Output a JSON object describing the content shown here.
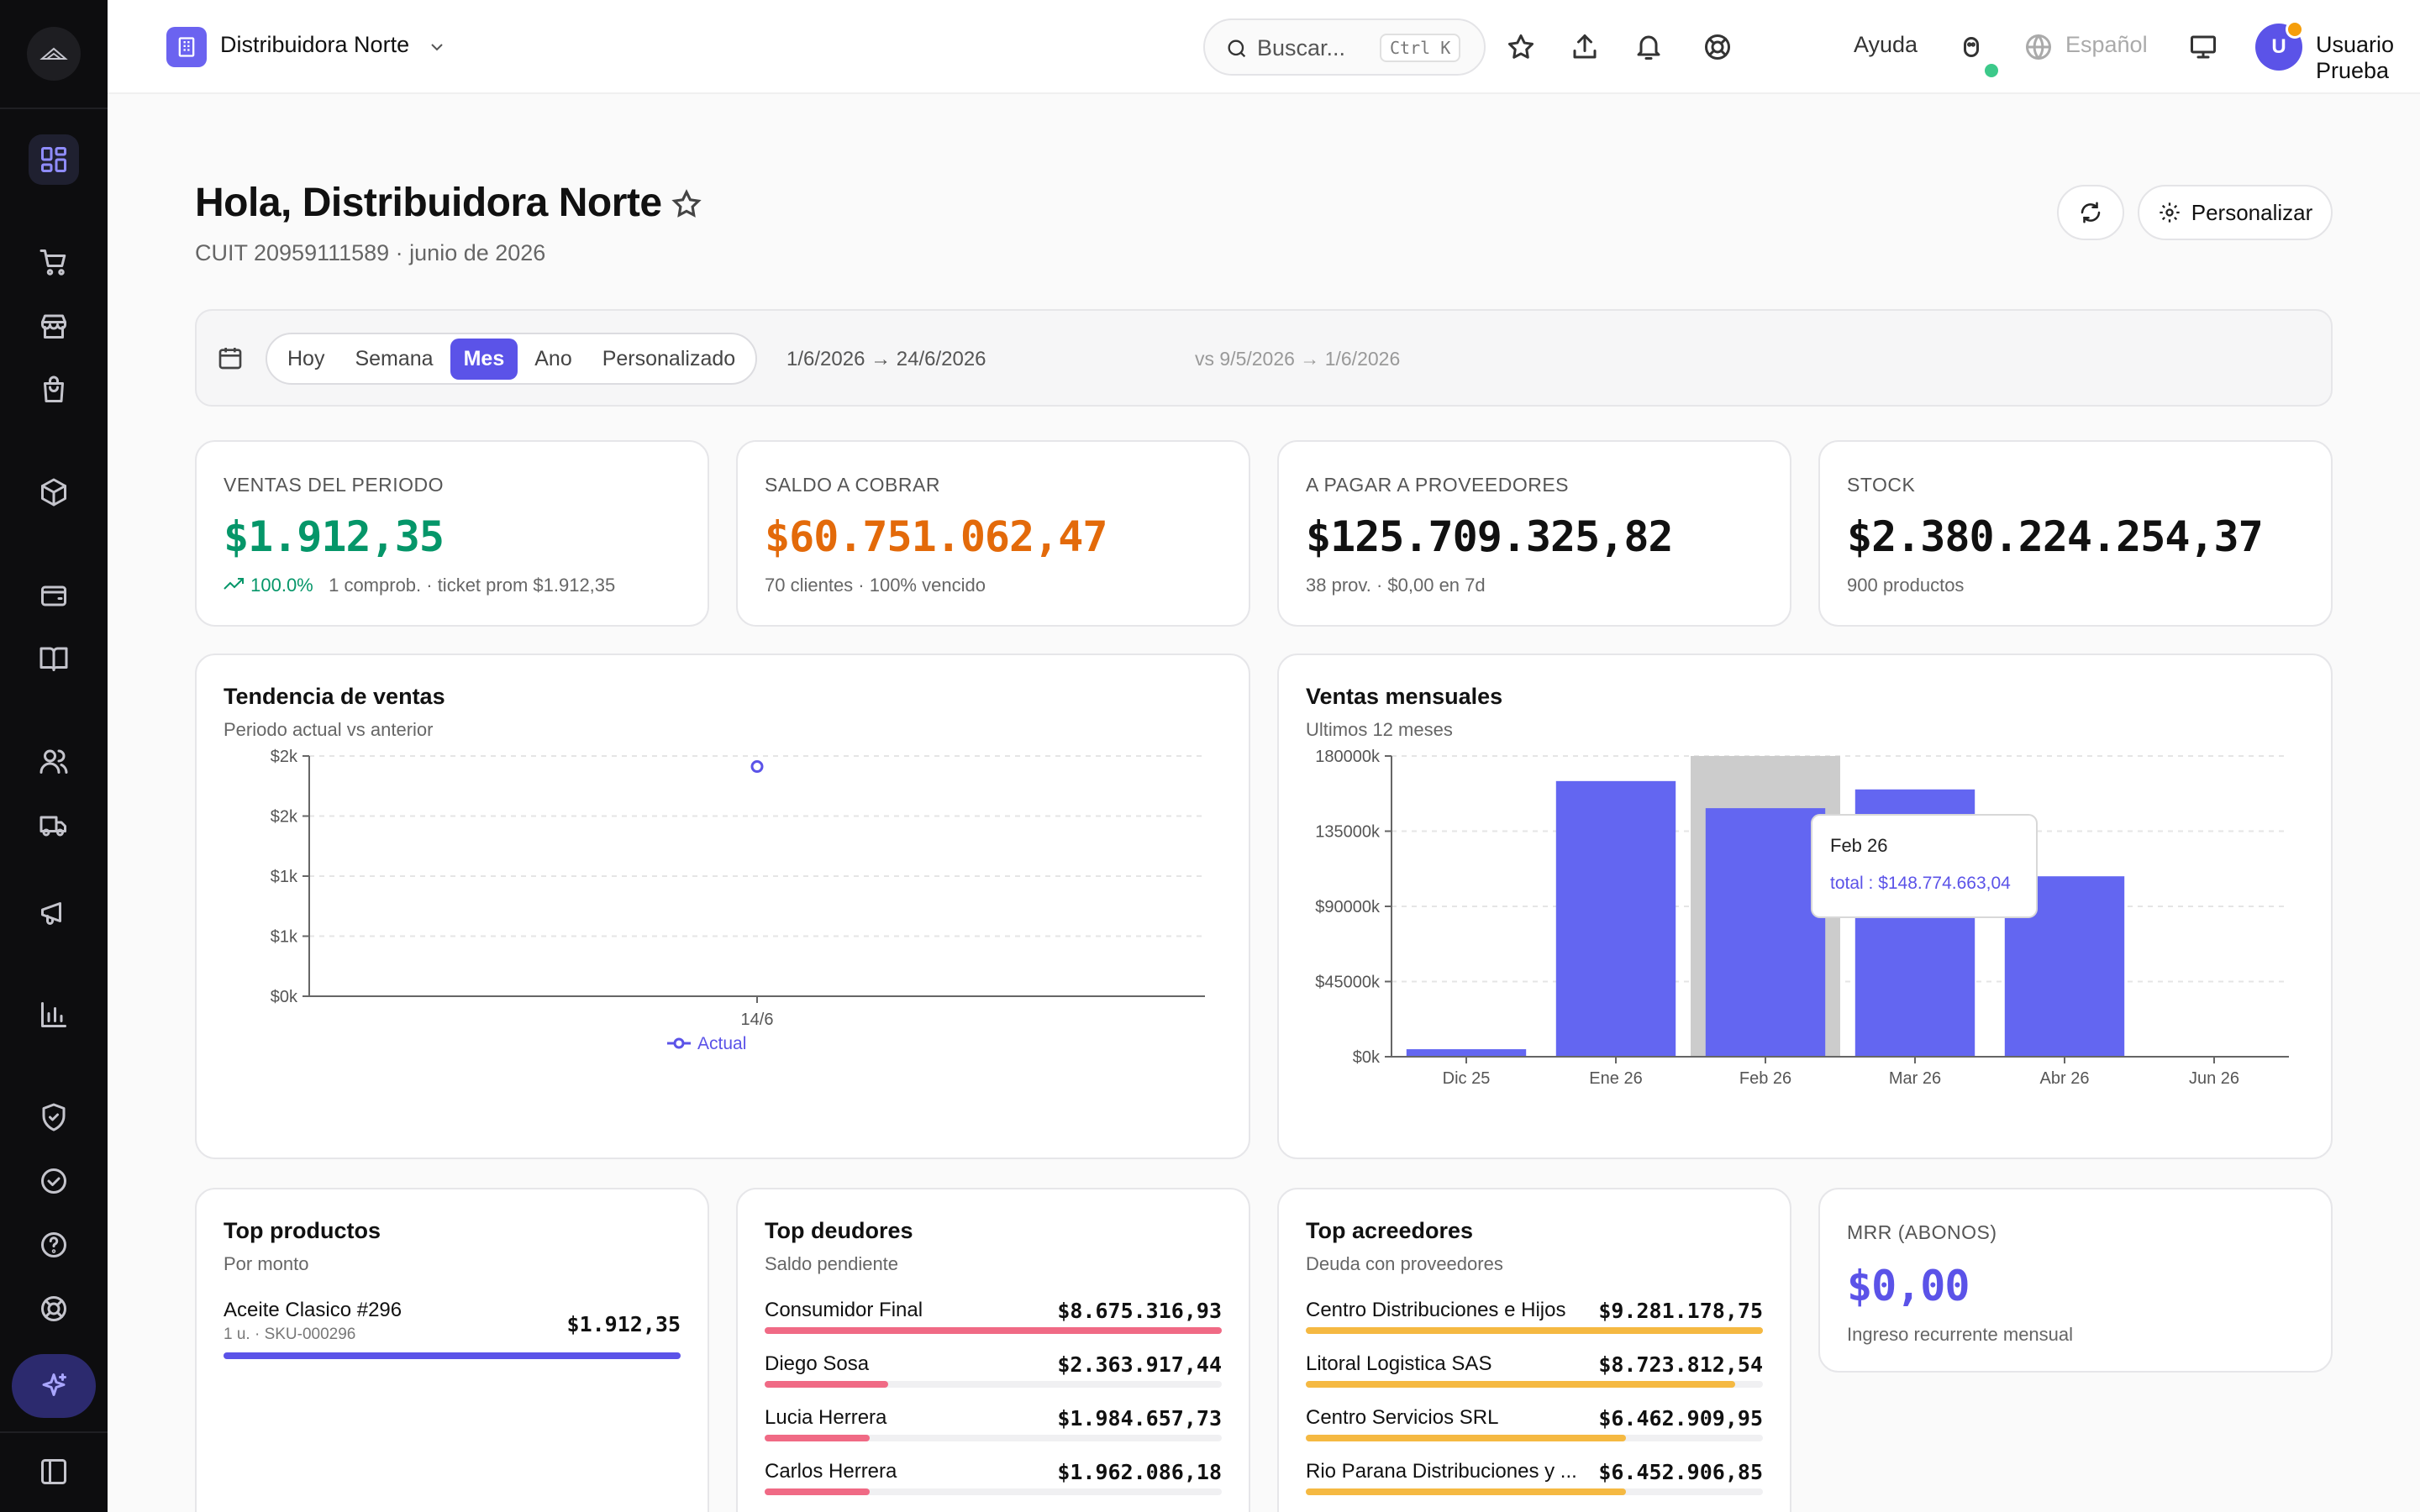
{
  "topbar": {
    "company": "Distribuidora Norte",
    "search_placeholder": "Buscar...",
    "search_shortcut": "Ctrl K",
    "help": "Ayuda",
    "language": "Español",
    "avatar_initial": "U",
    "user_name": "Usuario Prueba"
  },
  "header": {
    "title": "Hola, Distribuidora Norte",
    "subtitle": "CUIT 20959111589 · junio de 2026",
    "customize": "Personalizar"
  },
  "period": {
    "options": [
      "Hoy",
      "Semana",
      "Mes",
      "Ano",
      "Personalizado"
    ],
    "active": "Mes",
    "range": "1/6/2026 → 24/6/2026",
    "compare": "vs 9/5/2026 → 1/6/2026"
  },
  "kpis": [
    {
      "label": "VENTAS DEL PERIODO",
      "value": "$1.912,35",
      "trend": "100.0%",
      "sub": "1 comprob. · ticket prom $1.912,35",
      "color": "#059669"
    },
    {
      "label": "SALDO A COBRAR",
      "value": "$60.751.062,47",
      "sub": "70 clientes · 100% vencido",
      "color": "#e36a0a"
    },
    {
      "label": "A PAGAR A PROVEEDORES",
      "value": "$125.709.325,82",
      "sub": "38 prov. · $0,00 en 7d",
      "color": "#111111"
    },
    {
      "label": "STOCK",
      "value": "$2.380.224.254,37",
      "sub": "900 productos",
      "color": "#111111"
    }
  ],
  "trend": {
    "title": "Tendencia de ventas",
    "subtitle": "Periodo actual vs anterior"
  },
  "monthly": {
    "title": "Ventas mensuales",
    "subtitle": "Ultimos 12 meses",
    "tooltip_title": "Feb 26",
    "tooltip_value": "total : $148.774.663,04"
  },
  "chart_data": [
    {
      "type": "line",
      "title": "Tendencia de ventas",
      "x": [
        "14/6"
      ],
      "y_ticks": [
        "$0k",
        "$1k",
        "$1k",
        "$2k",
        "$2k"
      ],
      "ylim": [
        0,
        2000
      ],
      "series": [
        {
          "name": "Actual",
          "values": [
            1912.35
          ],
          "color": "#5b53e8"
        }
      ],
      "legend": "bottom",
      "grid": true
    },
    {
      "type": "bar",
      "title": "Ventas mensuales",
      "categories": [
        "Dic 25",
        "Ene 26",
        "Feb 26",
        "Mar 26",
        "Abr 26",
        "Jun 26"
      ],
      "values": [
        4500000,
        165000000,
        148774663.04,
        160000000,
        108000000,
        0
      ],
      "y_ticks": [
        "$0k",
        "$45000k",
        "$90000k",
        "135000k",
        "180000k"
      ],
      "ylim": [
        0,
        180000000
      ],
      "highlight": "Feb 26",
      "color": "#6366f1",
      "grid": true
    }
  ],
  "top_products": {
    "title": "Top productos",
    "subtitle": "Por monto",
    "items": [
      {
        "name": "Aceite Clasico #296",
        "meta": "1 u. · SKU-000296",
        "value": "$1.912,35",
        "share": 1.0
      }
    ]
  },
  "top_debtors": {
    "title": "Top deudores",
    "subtitle": "Saldo pendiente",
    "items": [
      {
        "name": "Consumidor Final",
        "value": "$8.675.316,93",
        "share": 1.0
      },
      {
        "name": "Diego Sosa",
        "value": "$2.363.917,44",
        "share": 0.27
      },
      {
        "name": "Lucia Herrera",
        "value": "$1.984.657,73",
        "share": 0.23
      },
      {
        "name": "Carlos Herrera",
        "value": "$1.962.086,18",
        "share": 0.23
      }
    ]
  },
  "top_creditors": {
    "title": "Top acreedores",
    "subtitle": "Deuda con proveedores",
    "items": [
      {
        "name": "Centro Distribuciones e Hijos",
        "value": "$9.281.178,75",
        "share": 1.0
      },
      {
        "name": "Litoral Logistica SAS",
        "value": "$8.723.812,54",
        "share": 0.94
      },
      {
        "name": "Centro Servicios SRL",
        "value": "$6.462.909,95",
        "share": 0.7
      },
      {
        "name": "Rio Parana Distribuciones y ...",
        "value": "$6.452.906,85",
        "share": 0.7
      }
    ]
  },
  "mrr": {
    "label": "MRR (ABONOS)",
    "value": "$0,00",
    "sub": "Ingreso recurrente mensual",
    "color": "#5b53e8"
  },
  "colors": {
    "accent": "#5b53e8",
    "debtor_bar": "#f06a85",
    "creditor_bar": "#f5b942"
  }
}
